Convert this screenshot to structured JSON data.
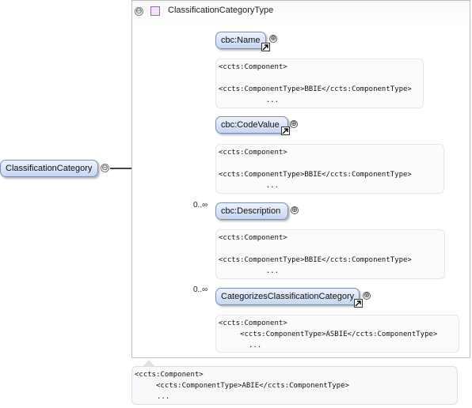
{
  "root": {
    "label": "ClassificationCategory"
  },
  "type": {
    "name": "ClassificationCategoryType"
  },
  "children": [
    {
      "label": "cbc:Name",
      "occurrence": "",
      "annotation": [
        "<ccts:Component>",
        "",
        "<ccts:ComponentType>BBIE</ccts:ComponentType>",
        "    ..."
      ]
    },
    {
      "label": "cbc:CodeValue",
      "occurrence": "",
      "annotation": [
        "<ccts:Component>",
        "",
        "<ccts:ComponentType>BBIE</ccts:ComponentType>",
        "    ..."
      ]
    },
    {
      "label": "cbc:Description",
      "occurrence": "0..∞",
      "annotation": [
        "<ccts:Component>",
        "",
        "<ccts:ComponentType>BBIE</ccts:ComponentType>",
        "    ..."
      ]
    },
    {
      "label": "CategorizesClassificationCategory",
      "occurrence": "0..∞",
      "annotation": [
        "<ccts:Component>",
        "     <ccts:ComponentType>ASBIE</ccts:ComponentType>",
        "..."
      ]
    }
  ],
  "root_annotation": [
    "<ccts:Component>",
    "     <ccts:ComponentType>ABIE</ccts:ComponentType>",
    "..."
  ],
  "icons": {
    "collapse": "⊖",
    "expand": "⊕",
    "sequence": "sequence-compositor-icon",
    "link": "link-arrow-icon",
    "type": "complex-type-icon"
  }
}
